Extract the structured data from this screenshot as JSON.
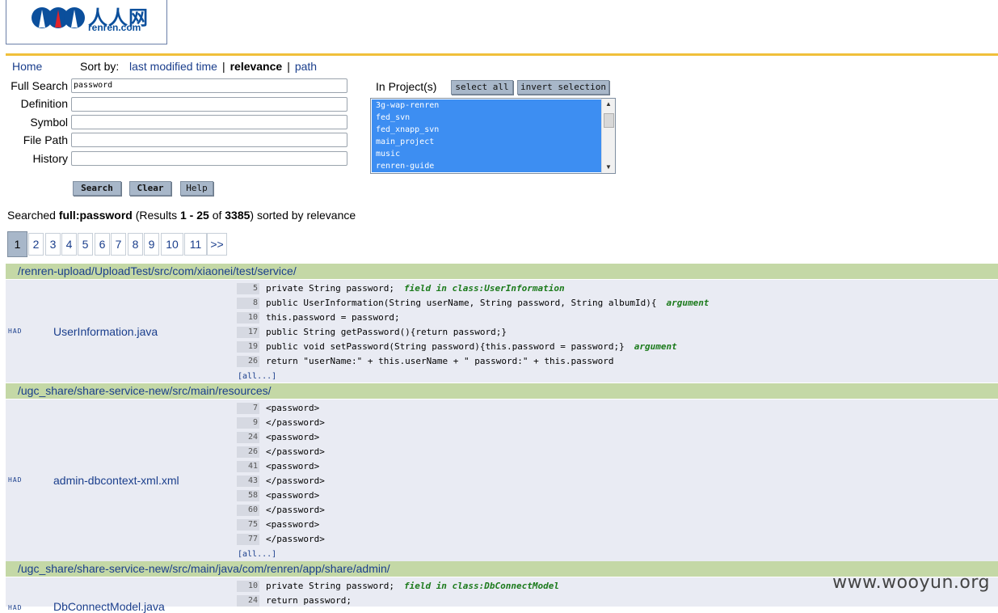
{
  "logo": {
    "cn": "人人网",
    "en": "renren.com"
  },
  "nav": {
    "home": "Home",
    "sort_by": "Sort by:",
    "sort_options": [
      "last modified time",
      "relevance",
      "path"
    ],
    "separator": "|"
  },
  "form": {
    "full_search": {
      "label": "Full Search",
      "value": "password"
    },
    "definition": {
      "label": "Definition",
      "value": ""
    },
    "symbol": {
      "label": "Symbol",
      "value": ""
    },
    "file_path": {
      "label": "File Path",
      "value": ""
    },
    "history": {
      "label": "History",
      "value": ""
    },
    "search_button": "Search",
    "clear_button": "Clear",
    "help_button": "Help"
  },
  "projects": {
    "label": "In Project(s)",
    "select_all": "select all",
    "invert_selection": "invert selection",
    "items": [
      "3g-wap-renren",
      "fed_svn",
      "fed_xnapp_svn",
      "main_project",
      "music",
      "renren-guide"
    ]
  },
  "summary": {
    "prefix": "Searched",
    "query": "full:password",
    "results_open": "(Results",
    "range": "1 - 25",
    "of": "of",
    "total": "3385",
    "suffix": ") sorted by relevance"
  },
  "pagination": {
    "current": "1",
    "pages": [
      "1",
      "2",
      "3",
      "4",
      "5",
      "6",
      "7",
      "8",
      "9",
      "10",
      "11",
      ">>"
    ]
  },
  "results": [
    {
      "dir": "/renren-upload/UploadTest/src/com/xiaonei/test/service/",
      "had": "HAD",
      "file": "UserInformation.java",
      "lines": [
        {
          "num": "5",
          "code": "private String password;",
          "hint": "field in class:UserInformation"
        },
        {
          "num": "8",
          "code": "public UserInformation(String userName, String password, String albumId){",
          "hint": "argument"
        },
        {
          "num": "10",
          "code": "this.password = password;",
          "hint": ""
        },
        {
          "num": "17",
          "code": "public String getPassword(){return password;}",
          "hint": ""
        },
        {
          "num": "19",
          "code": "public void setPassword(String password){this.password = password;}",
          "hint": "argument"
        },
        {
          "num": "26",
          "code": "return \"userName:\" + this.userName + \" password:\" + this.password",
          "hint": ""
        }
      ],
      "all": "[all...]"
    },
    {
      "dir": "/ugc_share/share-service-new/src/main/resources/",
      "had": "HAD",
      "file": "admin-dbcontext-xml.xml",
      "lines": [
        {
          "num": "7",
          "code": "<password>",
          "hint": ""
        },
        {
          "num": "9",
          "code": "</password>",
          "hint": ""
        },
        {
          "num": "24",
          "code": "<password>",
          "hint": ""
        },
        {
          "num": "26",
          "code": "</password>",
          "hint": ""
        },
        {
          "num": "41",
          "code": "<password>",
          "hint": ""
        },
        {
          "num": "43",
          "code": "</password>",
          "hint": ""
        },
        {
          "num": "58",
          "code": "<password>",
          "hint": ""
        },
        {
          "num": "60",
          "code": "</password>",
          "hint": ""
        },
        {
          "num": "75",
          "code": "<password>",
          "hint": ""
        },
        {
          "num": "77",
          "code": "</password>",
          "hint": ""
        }
      ],
      "all": "[all...]"
    },
    {
      "dir": "/ugc_share/share-service-new/src/main/java/com/renren/app/share/admin/",
      "had": "HAD",
      "file": "DbConnectModel.java",
      "lines": [
        {
          "num": "10",
          "code": "private String password;",
          "hint": "field in class:DbConnectModel"
        },
        {
          "num": "24",
          "code": "return password;",
          "hint": ""
        }
      ],
      "all": ""
    }
  ],
  "watermark": "www.wooyun.org"
}
